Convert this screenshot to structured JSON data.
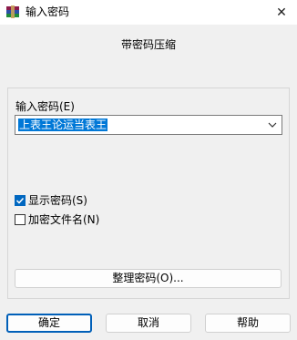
{
  "window": {
    "title": "输入密码",
    "close_glyph": "✕",
    "icon": "winrar-icon"
  },
  "dialog": {
    "subtitle": "带密码压缩",
    "password_label": "输入密码(E)",
    "password_value": "上表王论运当表王",
    "options": {
      "show_password_label": "显示密码(S)",
      "show_password_checked": true,
      "encrypt_filenames_label": "加密文件名(N)",
      "encrypt_filenames_checked": false
    },
    "manage_button_label": "整理密码(O)..."
  },
  "buttons": {
    "ok_label": "确定",
    "cancel_label": "取消",
    "help_label": "帮助"
  },
  "colors": {
    "accent": "#0067c0",
    "selection": "#0078d7"
  }
}
